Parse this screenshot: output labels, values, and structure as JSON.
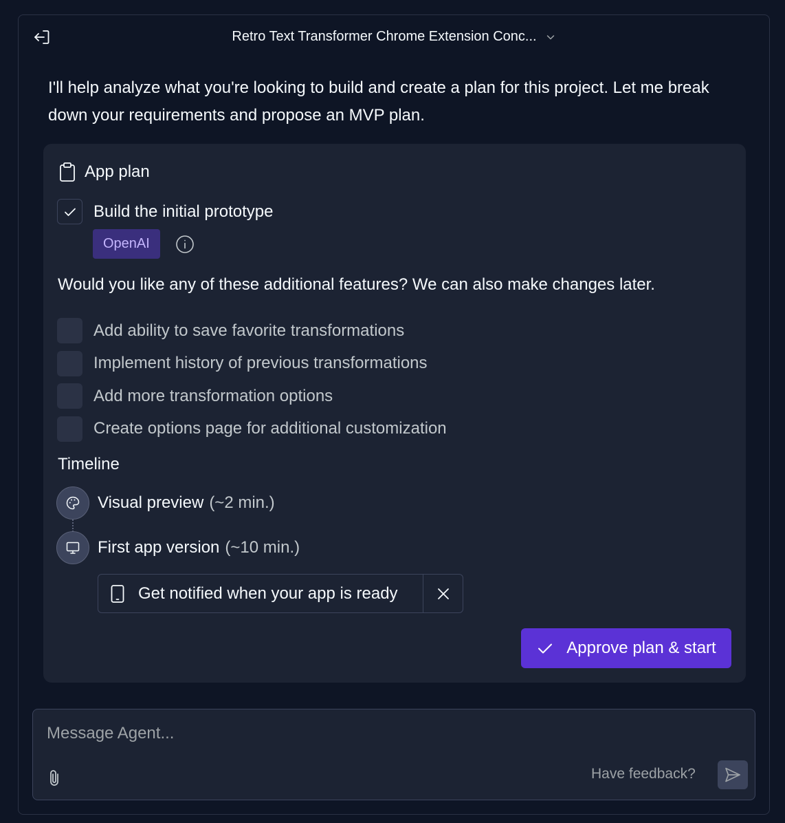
{
  "header": {
    "title": "Retro Text Transformer Chrome Extension Conc..."
  },
  "message": {
    "text": "I'll help analyze what you're looking to build and create a plan for this project. Let me break down your requirements and propose an MVP plan."
  },
  "plan": {
    "heading": "App plan",
    "prototype": {
      "label": "Build the initial prototype",
      "checked": true,
      "tag": "OpenAI"
    },
    "question": "Would you like any of these additional features? We can also make changes later.",
    "features": [
      {
        "label": "Add ability to save favorite transformations",
        "checked": false
      },
      {
        "label": "Implement history of previous transformations",
        "checked": false
      },
      {
        "label": "Add more transformation options",
        "checked": false
      },
      {
        "label": "Create options page for additional customization",
        "checked": false
      }
    ],
    "timeline": {
      "title": "Timeline",
      "steps": [
        {
          "label": "Visual preview",
          "duration": "(~2 min.)",
          "icon": "palette-icon"
        },
        {
          "label": "First app version",
          "duration": "(~10 min.)",
          "icon": "monitor-icon"
        }
      ]
    },
    "notify": {
      "label": "Get notified when your app is ready"
    },
    "approve_label": "Approve plan & start"
  },
  "composer": {
    "placeholder": "Message Agent...",
    "feedback_label": "Have feedback?"
  },
  "colors": {
    "background": "#0e1525",
    "card": "#1c2333",
    "accent": "#5b32d6",
    "tag_bg": "#3a2f7d",
    "tag_text": "#c4b5fd"
  }
}
